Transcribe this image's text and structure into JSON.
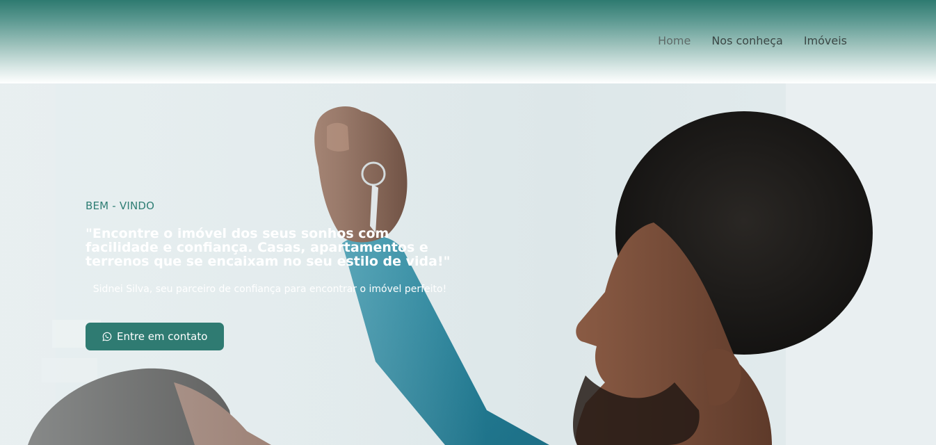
{
  "nav": {
    "items": [
      {
        "label": "Home",
        "active": true
      },
      {
        "label": "Nos conheça",
        "active": false
      },
      {
        "label": "Imóveis",
        "active": false
      }
    ]
  },
  "hero": {
    "eyebrow": "BEM - VINDO",
    "headline": "\"Encontre o imóvel dos seus sonhos com facilidade e confiança. Casas, apartamentos e terrenos que se encaixam no seu estilo de vida!\"",
    "subtitle": "Sidnei Silva, seu parceiro de confiança para encontrar o imóvel perfeito!",
    "cta_label": "Entre em contato",
    "cta_icon": "whatsapp-icon"
  },
  "colors": {
    "brand": "#2f7b72",
    "header_top": "#2e7a70",
    "eyebrow": "#2f7e74"
  }
}
